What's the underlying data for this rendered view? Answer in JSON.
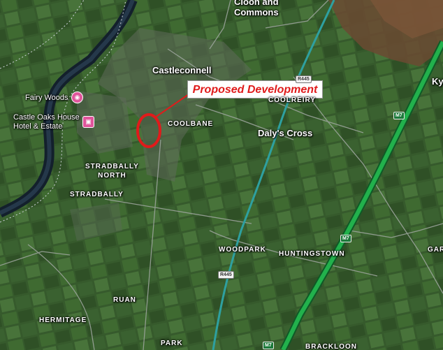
{
  "callout": {
    "text": "Proposed Development"
  },
  "places": {
    "cloon_line1": "Cloon and",
    "cloon_line2": "Commons",
    "castleconnell": "Castleconnell",
    "coolreiry": "COOLREIRY",
    "coolbane": "COOLBANE",
    "dalys_cross": "Daly's Cross",
    "kyl": "Kyl",
    "stradbally_north_line1": "STRADBALLY",
    "stradbally_north_line2": "NORTH",
    "stradbally": "STRADBALLY",
    "woodpark": "WOODPARK",
    "huntingstown": "HUNTINGSTOWN",
    "gar": "GAR",
    "ruan": "RUAN",
    "hermitage": "HERMITAGE",
    "park": "PARK",
    "bracklon": "BRACKLOON"
  },
  "pois": {
    "fairy_woods": "Fairy Woods",
    "castle_oaks_line1": "Castle Oaks House",
    "castle_oaks_line2": "Hotel & Estate"
  },
  "roads": {
    "r445_top": "R445",
    "r445_bottom": "R445",
    "m7_top": "M7",
    "m7_mid": "M7",
    "m7_bottom": "M7"
  },
  "icons": {
    "fairy_woods_pin": "camera-icon",
    "castle_oaks_pin": "hotel-icon",
    "development_marker": "red-circle-marker"
  },
  "colors": {
    "motorway": "#22b14c",
    "highlight": "#e01b1b",
    "river": "#1a2a3a"
  }
}
